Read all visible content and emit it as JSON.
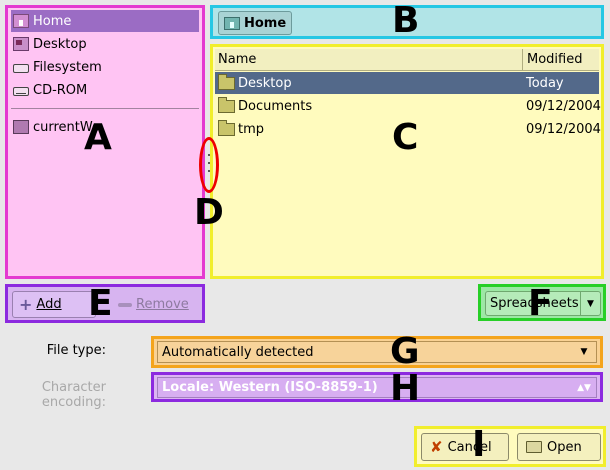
{
  "sidebar": {
    "items": [
      {
        "label": "Home",
        "icon": "home-folder-icon",
        "selected": true
      },
      {
        "label": "Desktop",
        "icon": "desktop-icon",
        "selected": false
      },
      {
        "label": "Filesystem",
        "icon": "harddisk-icon",
        "selected": false
      },
      {
        "label": "CD-ROM",
        "icon": "cdrom-icon",
        "selected": false
      }
    ],
    "bookmarks": [
      {
        "label": "currentWo",
        "icon": "folder-icon"
      }
    ]
  },
  "pathbar": {
    "home_label": "Home"
  },
  "filelist": {
    "columns": [
      "Name",
      "Modified"
    ],
    "rows": [
      {
        "name": "Desktop",
        "modified": "Today",
        "selected": true
      },
      {
        "name": "Documents",
        "modified": "09/12/2004",
        "selected": false
      },
      {
        "name": "tmp",
        "modified": "09/12/2004",
        "selected": false
      }
    ]
  },
  "actions": {
    "add_label": "Add",
    "remove_label": "Remove"
  },
  "filter": {
    "value": "Spreadsheets"
  },
  "form": {
    "file_type_label": "File type:",
    "file_type_value": "Automatically detected",
    "encoding_label": "Character encoding:",
    "encoding_value": "Locale: Western (ISO-8859-1)"
  },
  "buttons": {
    "cancel_label": "Cancel",
    "open_label": "Open"
  },
  "markers": [
    "A",
    "B",
    "C",
    "D",
    "E",
    "F",
    "G",
    "H",
    "I"
  ],
  "colors": {
    "region_a": "#e43ad0",
    "region_b": "#26c7e4",
    "region_c": "#f1ee2c",
    "region_d": "#ee0000",
    "region_e": "#8c2adf",
    "region_f": "#27cf27",
    "region_g": "#f4a41c",
    "region_h": "#8c2adf",
    "region_i": "#f1ee2c",
    "selection": "#53698a"
  }
}
